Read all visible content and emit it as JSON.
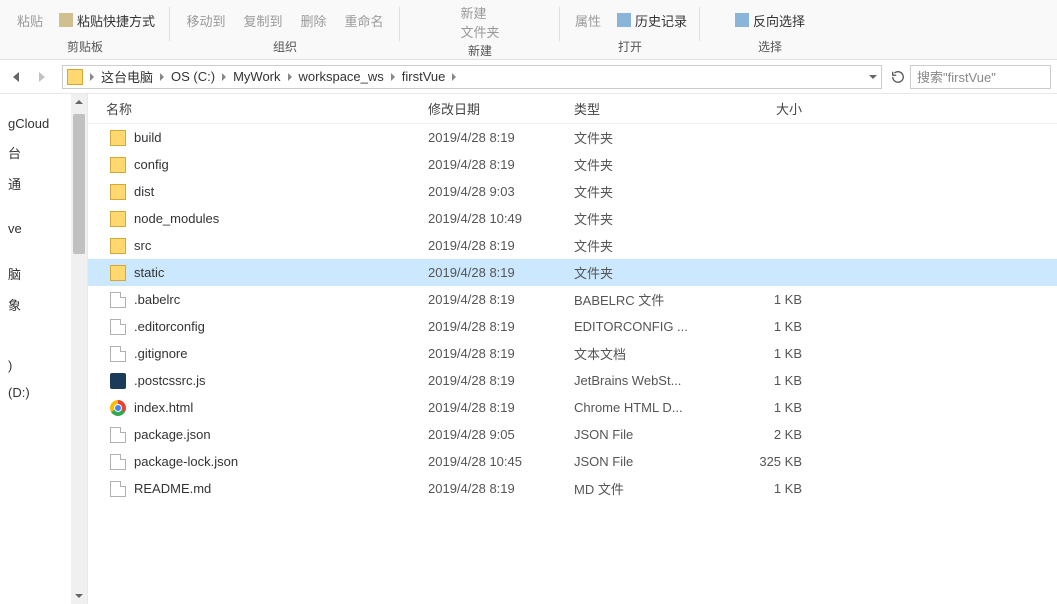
{
  "ribbon": {
    "clipboard": {
      "label": "剪贴板",
      "paste": "粘贴",
      "paste_shortcut": "粘贴快捷方式"
    },
    "organize": {
      "label": "组织",
      "move_to": "移动到",
      "copy_to": "复制到",
      "delete": "删除",
      "rename": "重命名"
    },
    "new": {
      "label": "新建",
      "new_folder": "新建\n文件夹"
    },
    "open": {
      "label": "打开",
      "properties": "属性",
      "history": "历史记录"
    },
    "select": {
      "label": "选择",
      "invert": "反向选择"
    }
  },
  "breadcrumbs": [
    "这台电脑",
    "OS (C:)",
    "MyWork",
    "workspace_ws",
    "firstVue"
  ],
  "search_placeholder": "搜索\"firstVue\"",
  "columns": {
    "name": "名称",
    "date": "修改日期",
    "type": "类型",
    "size": "大小"
  },
  "sidebar_items": [
    "",
    "gCloud",
    "台",
    "通",
    "",
    "ve",
    "",
    "脑",
    "象",
    "",
    "",
    ")",
    "(D:)"
  ],
  "selected_index": 5,
  "files": [
    {
      "icon": "folder",
      "name": "build",
      "date": "2019/4/28 8:19",
      "type": "文件夹",
      "size": ""
    },
    {
      "icon": "folder",
      "name": "config",
      "date": "2019/4/28 8:19",
      "type": "文件夹",
      "size": ""
    },
    {
      "icon": "folder",
      "name": "dist",
      "date": "2019/4/28 9:03",
      "type": "文件夹",
      "size": ""
    },
    {
      "icon": "folder",
      "name": "node_modules",
      "date": "2019/4/28 10:49",
      "type": "文件夹",
      "size": ""
    },
    {
      "icon": "folder",
      "name": "src",
      "date": "2019/4/28 8:19",
      "type": "文件夹",
      "size": ""
    },
    {
      "icon": "folder",
      "name": "static",
      "date": "2019/4/28 8:19",
      "type": "文件夹",
      "size": ""
    },
    {
      "icon": "file",
      "name": ".babelrc",
      "date": "2019/4/28 8:19",
      "type": "BABELRC 文件",
      "size": "1 KB"
    },
    {
      "icon": "file",
      "name": ".editorconfig",
      "date": "2019/4/28 8:19",
      "type": "EDITORCONFIG ...",
      "size": "1 KB"
    },
    {
      "icon": "file",
      "name": ".gitignore",
      "date": "2019/4/28 8:19",
      "type": "文本文档",
      "size": "1 KB"
    },
    {
      "icon": "ws",
      "name": ".postcssrc.js",
      "date": "2019/4/28 8:19",
      "type": "JetBrains WebSt...",
      "size": "1 KB"
    },
    {
      "icon": "chrome",
      "name": "index.html",
      "date": "2019/4/28 8:19",
      "type": "Chrome HTML D...",
      "size": "1 KB"
    },
    {
      "icon": "file",
      "name": "package.json",
      "date": "2019/4/28 9:05",
      "type": "JSON File",
      "size": "2 KB"
    },
    {
      "icon": "file",
      "name": "package-lock.json",
      "date": "2019/4/28 10:45",
      "type": "JSON File",
      "size": "325 KB"
    },
    {
      "icon": "file",
      "name": "README.md",
      "date": "2019/4/28 8:19",
      "type": "MD 文件",
      "size": "1 KB"
    }
  ]
}
